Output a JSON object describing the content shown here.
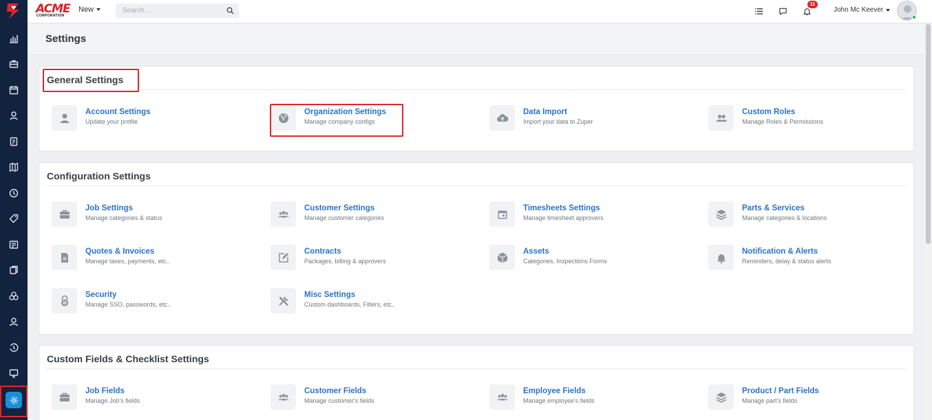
{
  "app": {
    "brand_main": "ACME",
    "brand_sub": "CORPORATION"
  },
  "topbar": {
    "new_label": "New",
    "search_placeholder": "Search...",
    "notification_count": "11",
    "user_name": "John Mc Keever"
  },
  "page": {
    "title": "Settings"
  },
  "sections": [
    {
      "title": "General Settings",
      "items": [
        {
          "title": "Account Settings",
          "subtitle": "Update your profile",
          "icon": "user-icon"
        },
        {
          "title": "Organization Settings",
          "subtitle": "Manage company configs",
          "icon": "globe-icon"
        },
        {
          "title": "Data Import",
          "subtitle": "Import your data to Zuper",
          "icon": "cloud-upload-icon"
        },
        {
          "title": "Custom Roles",
          "subtitle": "Manage Roles & Permissions",
          "icon": "users-icon"
        }
      ]
    },
    {
      "title": "Configuration Settings",
      "items": [
        {
          "title": "Job Settings",
          "subtitle": "Manage categories & status",
          "icon": "briefcase-icon"
        },
        {
          "title": "Customer Settings",
          "subtitle": "Manage customer categories",
          "icon": "group-icon"
        },
        {
          "title": "Timesheets Settings",
          "subtitle": "Manage timesheet approvers",
          "icon": "calendar-icon"
        },
        {
          "title": "Parts & Services",
          "subtitle": "Manage categories & locations",
          "icon": "layers-icon"
        },
        {
          "title": "Quotes & Invoices",
          "subtitle": "Manage taxes, payments, etc..",
          "icon": "document-icon"
        },
        {
          "title": "Contracts",
          "subtitle": "Packages, billing & approvers",
          "icon": "edit-icon"
        },
        {
          "title": "Assets",
          "subtitle": "Categories, Inspections Forms",
          "icon": "box-icon"
        },
        {
          "title": "Notification & Alerts",
          "subtitle": "Reminders, delay & status alerts",
          "icon": "bell-icon"
        },
        {
          "title": "Security",
          "subtitle": "Manage SSO, passwords, etc..",
          "icon": "lock-icon"
        },
        {
          "title": "Misc Settings",
          "subtitle": "Custom dashboards, Filters, etc..",
          "icon": "tools-icon"
        }
      ]
    },
    {
      "title": "Custom Fields & Checklist Settings",
      "items": [
        {
          "title": "Job Fields",
          "subtitle": "Manage Job's fields",
          "icon": "briefcase-icon"
        },
        {
          "title": "Customer Fields",
          "subtitle": "Manage customer's fields",
          "icon": "group-icon"
        },
        {
          "title": "Employee Fields",
          "subtitle": "Manage employee's fields",
          "icon": "group-icon"
        },
        {
          "title": "Product / Part Fields",
          "subtitle": "Manage part's fields",
          "icon": "layers-icon"
        }
      ]
    }
  ],
  "colors": {
    "sidebar_bg": "#12233f",
    "link_blue": "#2a73c9",
    "highlight_red": "#e0262d",
    "active_rail": "#1b8fd6"
  }
}
